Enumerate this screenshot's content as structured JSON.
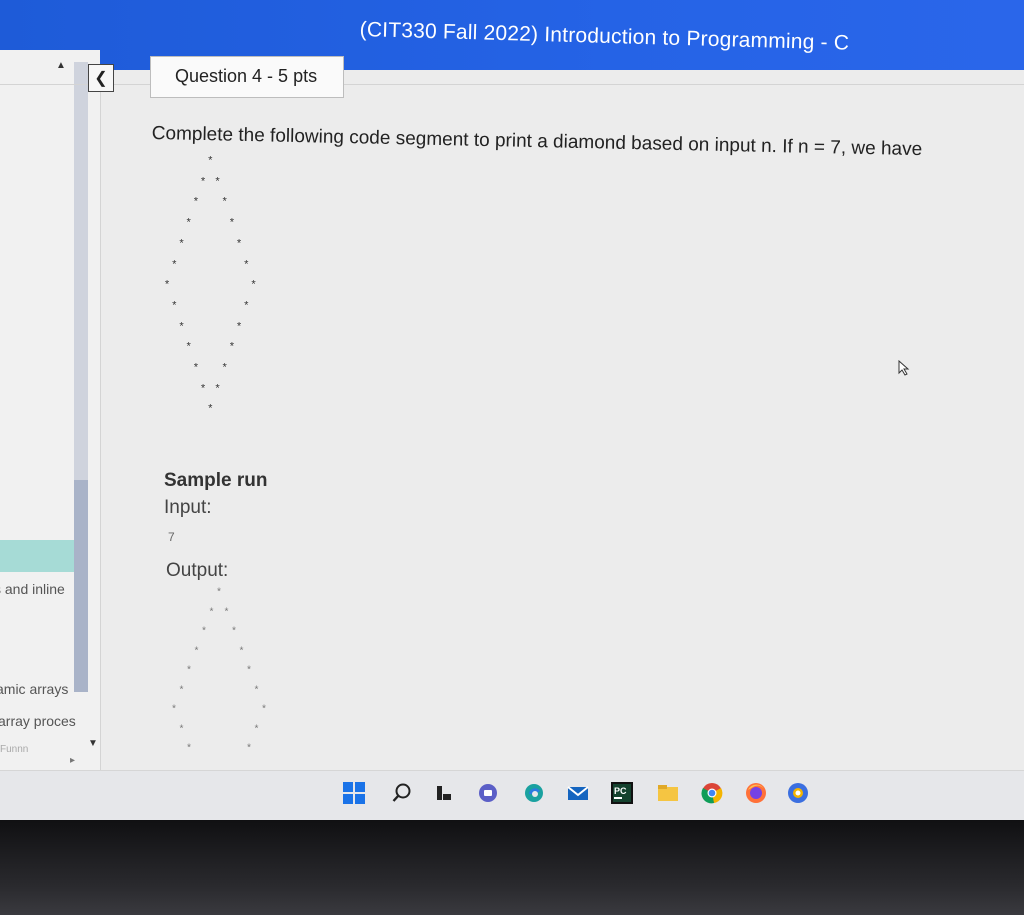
{
  "window": {
    "title": "(CIT330 Fall 2022) Introduction to Programming - C"
  },
  "sidebar": {
    "items": [
      {
        "label": "s and inline"
      },
      {
        "label": "amic arrays"
      },
      {
        "label": "array proces"
      },
      {
        "label": "Funnn"
      }
    ]
  },
  "question": {
    "header": "Question 4 - 5 pts",
    "text": "Complete the following code segment to print a diamond based on input n. If n = 7, we have",
    "diamond_char": "*",
    "sample_title": "Sample run",
    "input_label": "Input:",
    "input_value": "7",
    "output_label": "Output:"
  },
  "taskbar": {
    "icons": [
      {
        "name": "windows-start-icon"
      },
      {
        "name": "search-icon"
      },
      {
        "name": "task-view-icon"
      },
      {
        "name": "chat-icon"
      },
      {
        "name": "edge-browser-icon"
      },
      {
        "name": "mail-icon"
      },
      {
        "name": "pycharm-icon",
        "label": "PC"
      },
      {
        "name": "file-explorer-icon"
      },
      {
        "name": "chrome-icon"
      },
      {
        "name": "firefox-icon"
      },
      {
        "name": "app-icon"
      }
    ]
  },
  "colors": {
    "titlebar": "#2563e6",
    "accent_teal": "#a6dbd6",
    "scroll_thumb": "#a9b3c8"
  }
}
